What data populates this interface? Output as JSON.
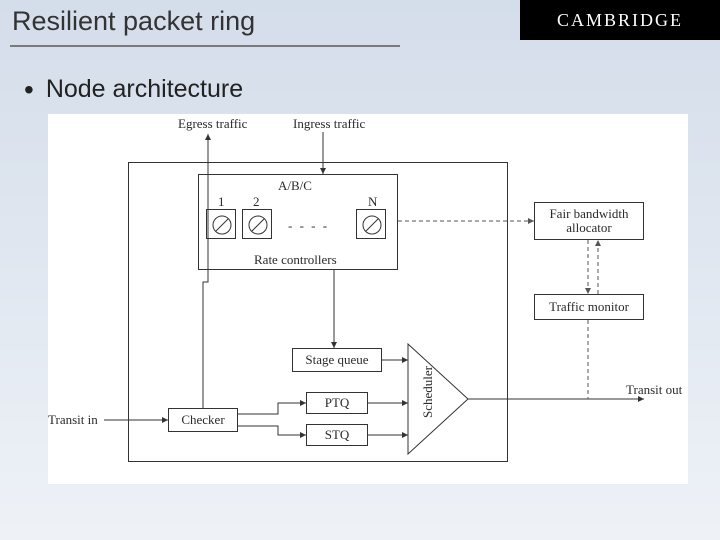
{
  "header": {
    "title": "Resilient packet ring",
    "logo": "CAMBRIDGE"
  },
  "bullet": {
    "text": "Node architecture"
  },
  "diagram": {
    "egress": "Egress traffic",
    "ingress": "Ingress traffic",
    "abc": "A/B/C",
    "n1": "1",
    "n2": "2",
    "nN": "N",
    "dots": "- - - -",
    "rate_controllers": "Rate controllers",
    "fair_bw": "Fair bandwidth allocator",
    "traffic_monitor": "Traffic monitor",
    "stage_queue": "Stage queue",
    "ptq": "PTQ",
    "stq": "STQ",
    "scheduler": "Scheduler",
    "checker": "Checker",
    "transit_in": "Transit in",
    "transit_out": "Transit out"
  }
}
